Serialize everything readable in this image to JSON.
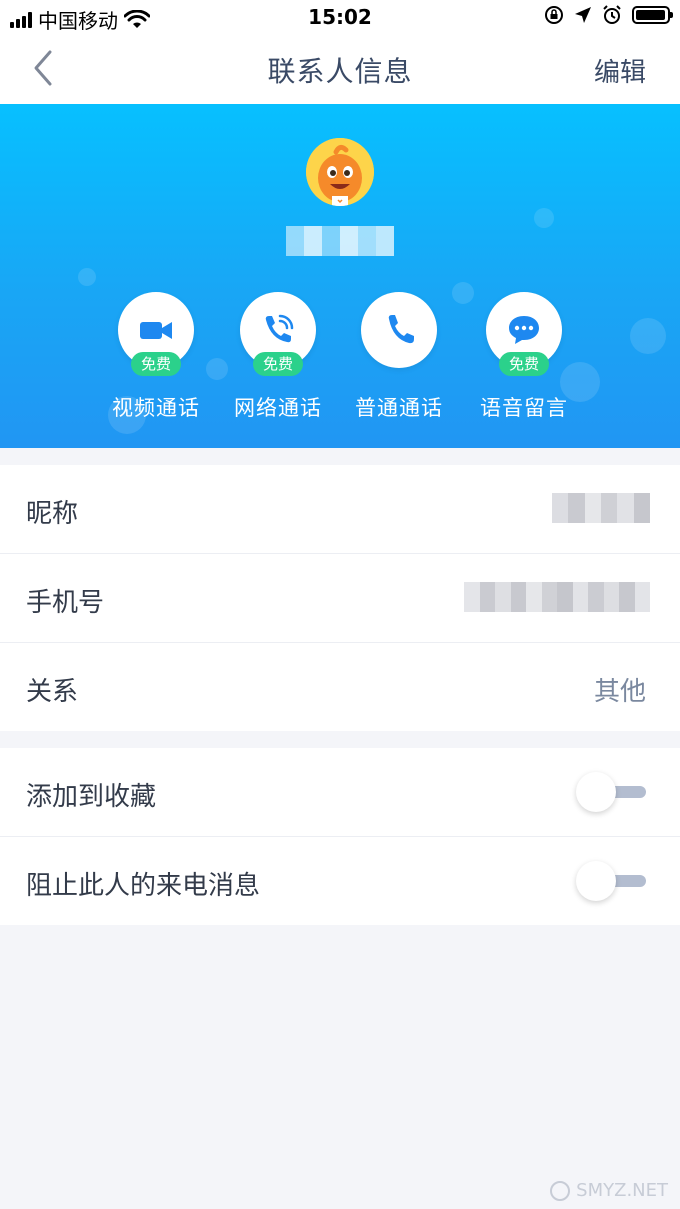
{
  "status_bar": {
    "carrier": "中国移动",
    "time": "15:02"
  },
  "nav": {
    "title": "联系人信息",
    "edit_label": "编辑"
  },
  "profile": {
    "actions": [
      {
        "label": "视频通话",
        "badge": "免费",
        "icon": "video-call-icon"
      },
      {
        "label": "网络通话",
        "badge": "免费",
        "icon": "network-call-icon"
      },
      {
        "label": "普通通话",
        "icon": "phone-icon"
      },
      {
        "label": "语音留言",
        "badge": "免费",
        "icon": "voice-message-icon"
      }
    ]
  },
  "info": {
    "nickname_label": "昵称",
    "phone_label": "手机号",
    "relation_label": "关系",
    "relation_value": "其他"
  },
  "settings": {
    "favorite_label": "添加到收藏",
    "favorite_on": false,
    "block_label": "阻止此人的来电消息",
    "block_on": false
  },
  "watermark": "SMYZ.NET",
  "colors": {
    "hero_top": "#07c0ff",
    "hero_bottom": "#2196f3",
    "badge_green": "#2bd18b",
    "text_navy": "#3a4a66",
    "accent_blue": "#1e88f0"
  }
}
